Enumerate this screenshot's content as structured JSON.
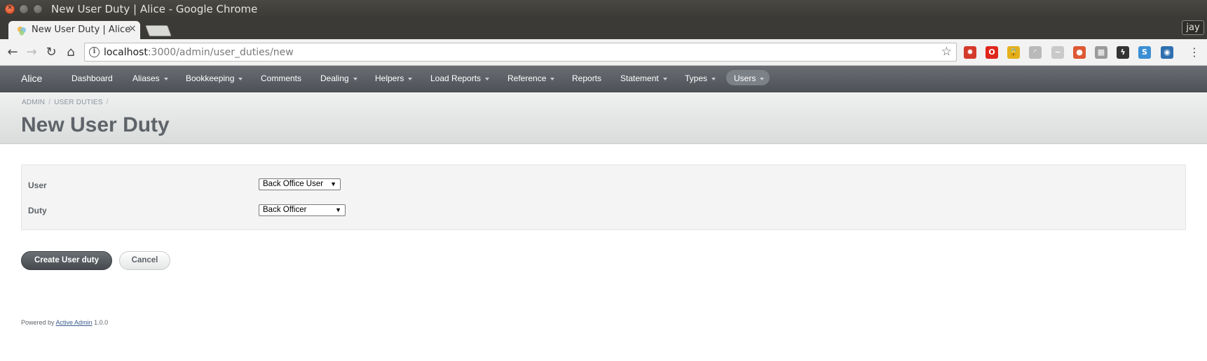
{
  "window": {
    "title": "New User Duty | Alice - Google Chrome"
  },
  "browser": {
    "tab_title": "New User Duty | Alice",
    "tab_close": "×",
    "profile": "jay",
    "url_host": "localhost",
    "url_path": ":3000/admin/user_duties/new",
    "extensions": [
      {
        "name": "bug-ext-icon",
        "color": "#d43a2a",
        "glyph": "✹"
      },
      {
        "name": "opera-ext-icon",
        "color": "#e0261b",
        "glyph": "O"
      },
      {
        "name": "lock-ext-icon",
        "color": "#e3b11c",
        "glyph": "🔒"
      },
      {
        "name": "feed-ext-icon",
        "color": "#b9b9b9",
        "glyph": "◜"
      },
      {
        "name": "rss-ext-icon",
        "color": "#c9c9c9",
        "glyph": "~"
      },
      {
        "name": "duckduckgo-ext-icon",
        "color": "#de5833",
        "glyph": "●"
      },
      {
        "name": "grid-ext-icon",
        "color": "#9a9a9a",
        "glyph": "▦"
      },
      {
        "name": "bolt-ext-icon",
        "color": "#333333",
        "glyph": "ϟ"
      },
      {
        "name": "s-ext-icon",
        "color": "#3b8fd4",
        "glyph": "S"
      },
      {
        "name": "ship-ext-icon",
        "color": "#2f6fb0",
        "glyph": "◉"
      }
    ]
  },
  "header": {
    "brand": "Alice",
    "nav": [
      {
        "label": "Dashboard",
        "dropdown": false
      },
      {
        "label": "Aliases",
        "dropdown": true
      },
      {
        "label": "Bookkeeping",
        "dropdown": true
      },
      {
        "label": "Comments",
        "dropdown": false
      },
      {
        "label": "Dealing",
        "dropdown": true
      },
      {
        "label": "Helpers",
        "dropdown": true
      },
      {
        "label": "Load Reports",
        "dropdown": true
      },
      {
        "label": "Reference",
        "dropdown": true
      },
      {
        "label": "Reports",
        "dropdown": false
      },
      {
        "label": "Statement",
        "dropdown": true
      },
      {
        "label": "Types",
        "dropdown": true
      },
      {
        "label": "Users",
        "dropdown": true,
        "current": true
      }
    ]
  },
  "breadcrumb": {
    "items": [
      "ADMIN",
      "USER DUTIES"
    ],
    "separator": "/"
  },
  "page": {
    "title": "New User Duty"
  },
  "form": {
    "user_label": "User",
    "user_value": "Back Office User",
    "duty_label": "Duty",
    "duty_value": "Back Officer",
    "submit_label": "Create User duty",
    "cancel_label": "Cancel"
  },
  "footer": {
    "prefix": "Powered by",
    "link": "Active Admin",
    "version": "1.0.0"
  }
}
